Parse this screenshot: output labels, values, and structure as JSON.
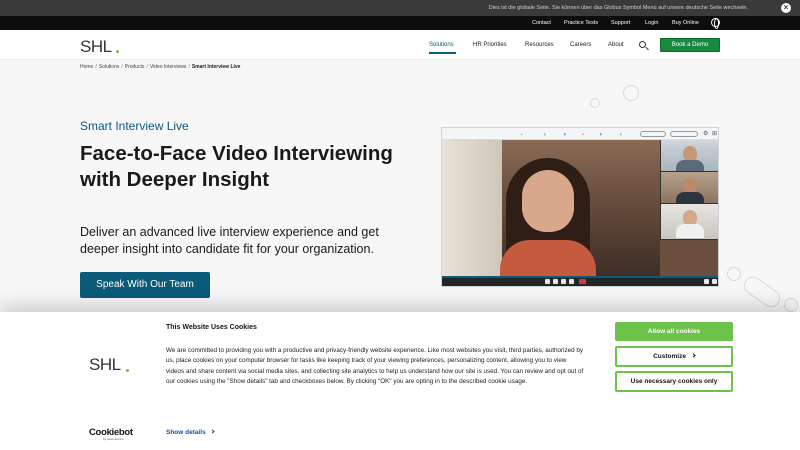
{
  "notice_bar": {
    "text": "Dies ist die globale Seite. Sie können über das Globus Symbol Menü auf unsere deutsche Seite wechseln."
  },
  "utility_nav": [
    "Contact",
    "Practice Tests",
    "Support",
    "Login",
    "Buy Online"
  ],
  "logo_text": "SHL",
  "main_nav": {
    "items": [
      "Solutions",
      "HR Priorities",
      "Resources",
      "Careers",
      "About"
    ],
    "active": "Solutions",
    "book_demo": "Book a Demo"
  },
  "breadcrumb": [
    "Home",
    "Solutions",
    "Products",
    "Video Interviews",
    "Smart Interview Live"
  ],
  "hero": {
    "eyebrow": "Smart Interview Live",
    "headline": "Face-to-Face Video Interviewing with Deeper Insight",
    "subhead": "Deliver an advanced live interview experience and get deeper insight into candidate fit for your organization.",
    "cta": "Speak With Our Team"
  },
  "cookie": {
    "title": "This Website Uses Cookies",
    "body": "We are committed to providing you with a productive and privacy-friendly website experience. Like most websites you visit, third parties, authorized by us, place cookies on your computer browser for tasks like keeping track of your viewing preferences, personalizing content, allowing you to view videos and share content via social media sites, and collecting site analytics to help us understand how our site is used. You can review and opt out of our cookies using the \"Show details\" tab and checkboxes below. By clicking \"OK\" you are opting in to the described cookie usage.",
    "show_details": "Show details",
    "allow_all": "Allow all cookies",
    "customize": "Customize",
    "necessary_only": "Use necessary cookies only",
    "cookiebot": "Cookiebot",
    "cookiebot_sub": "by Usercentrics"
  },
  "colors": {
    "brand_teal": "#0a5a7a",
    "demo_green": "#178a3f",
    "cookie_green": "#6cc24a"
  }
}
